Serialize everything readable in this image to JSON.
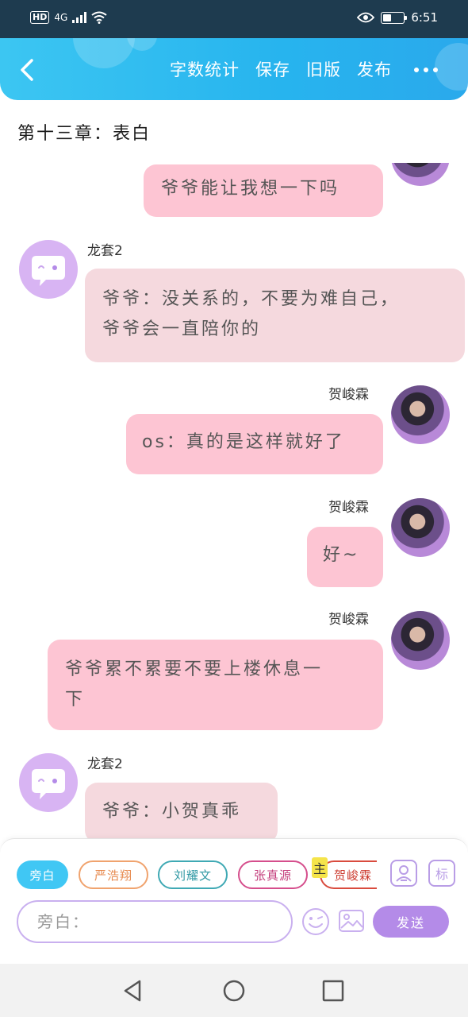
{
  "status_bar": {
    "hd": "HD",
    "network": "4G",
    "time": "6:51",
    "battery_level": 0.4
  },
  "header": {
    "actions": [
      "字数统计",
      "保存",
      "旧版",
      "发布"
    ]
  },
  "chapter_title": "第十三章：表白",
  "messages": [
    {
      "side": "right",
      "speaker": "",
      "text": "爷爷能让我想一下吗"
    },
    {
      "side": "left",
      "speaker": "龙套2",
      "text_line1": "爷爷：没关系的，不要为难自己，",
      "text_line2": "爷爷会一直陪你的"
    },
    {
      "side": "right",
      "speaker": "贺峻霖",
      "text": "os：真的是这样就好了"
    },
    {
      "side": "right",
      "speaker": "贺峻霖",
      "text": "好~"
    },
    {
      "side": "right",
      "speaker": "贺峻霖",
      "text_line1": "爷爷累不累要不要上楼休息一",
      "text_line2": "下"
    },
    {
      "side": "left",
      "speaker": "龙套2",
      "text": "爷爷：小贺真乖"
    }
  ],
  "composer": {
    "roles": [
      "旁白",
      "严浩翔",
      "刘耀文",
      "张真源",
      "贺峻霖"
    ],
    "main_badge": "主",
    "tag_icon_label": "标",
    "input_placeholder": "旁白：",
    "send_label": "发送"
  },
  "colors": {
    "header_start": "#3cc6f2",
    "header_end": "#2aa9ec",
    "bubble_right": "#fdc5d3",
    "bubble_left": "#f5d9de",
    "send": "#b48be8",
    "chip_active": "#40c7f4",
    "chip_yan": "#f0a36e",
    "chip_liu": "#3fa9b4",
    "chip_zhang": "#d54e8c",
    "chip_he": "#d94b3e"
  }
}
